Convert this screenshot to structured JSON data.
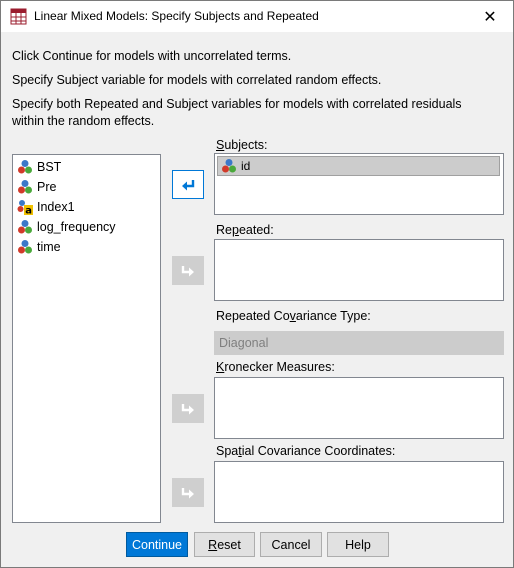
{
  "window": {
    "title": "Linear Mixed Models: Specify Subjects and Repeated"
  },
  "instructions": {
    "line1": "Click Continue for models with uncorrelated terms.",
    "line2": "Specify Subject variable for models with correlated random effects.",
    "line3a": "Specify both Repeated and Subject variables for models with correlated residuals",
    "line3b": "within the random effects."
  },
  "variables": [
    {
      "name": "BST",
      "icon": "scale-variable-icon"
    },
    {
      "name": "Pre",
      "icon": "scale-variable-icon"
    },
    {
      "name": "Index1",
      "icon": "nominal-string-variable-icon"
    },
    {
      "name": "log_frequency",
      "icon": "scale-variable-icon"
    },
    {
      "name": "time",
      "icon": "scale-variable-icon"
    }
  ],
  "subjects": {
    "label_pre": "",
    "label_u": "S",
    "label_post": "ubjects:",
    "items": [
      {
        "name": "id",
        "icon": "scale-variable-icon",
        "selected": true
      }
    ]
  },
  "repeated": {
    "label_pre": "Re",
    "label_u": "p",
    "label_post": "eated:"
  },
  "repeated_covariance": {
    "label_pre": "Repeated Co",
    "label_u": "v",
    "label_post": "ariance Type:",
    "value": "Diagonal",
    "enabled": false
  },
  "kronecker": {
    "label_pre": "",
    "label_u": "K",
    "label_post": "ronecker Measures:"
  },
  "spatial": {
    "label_pre": "Spa",
    "label_u": "t",
    "label_post": "ial Covariance Coordinates:"
  },
  "buttons": {
    "continue": "Continue",
    "reset_u": "R",
    "reset_rest": "eset",
    "cancel": "Cancel",
    "help": "Help"
  },
  "colors": {
    "accent": "#0078d7",
    "selection": "#cccccc",
    "disabled": "#cfcfcf"
  }
}
